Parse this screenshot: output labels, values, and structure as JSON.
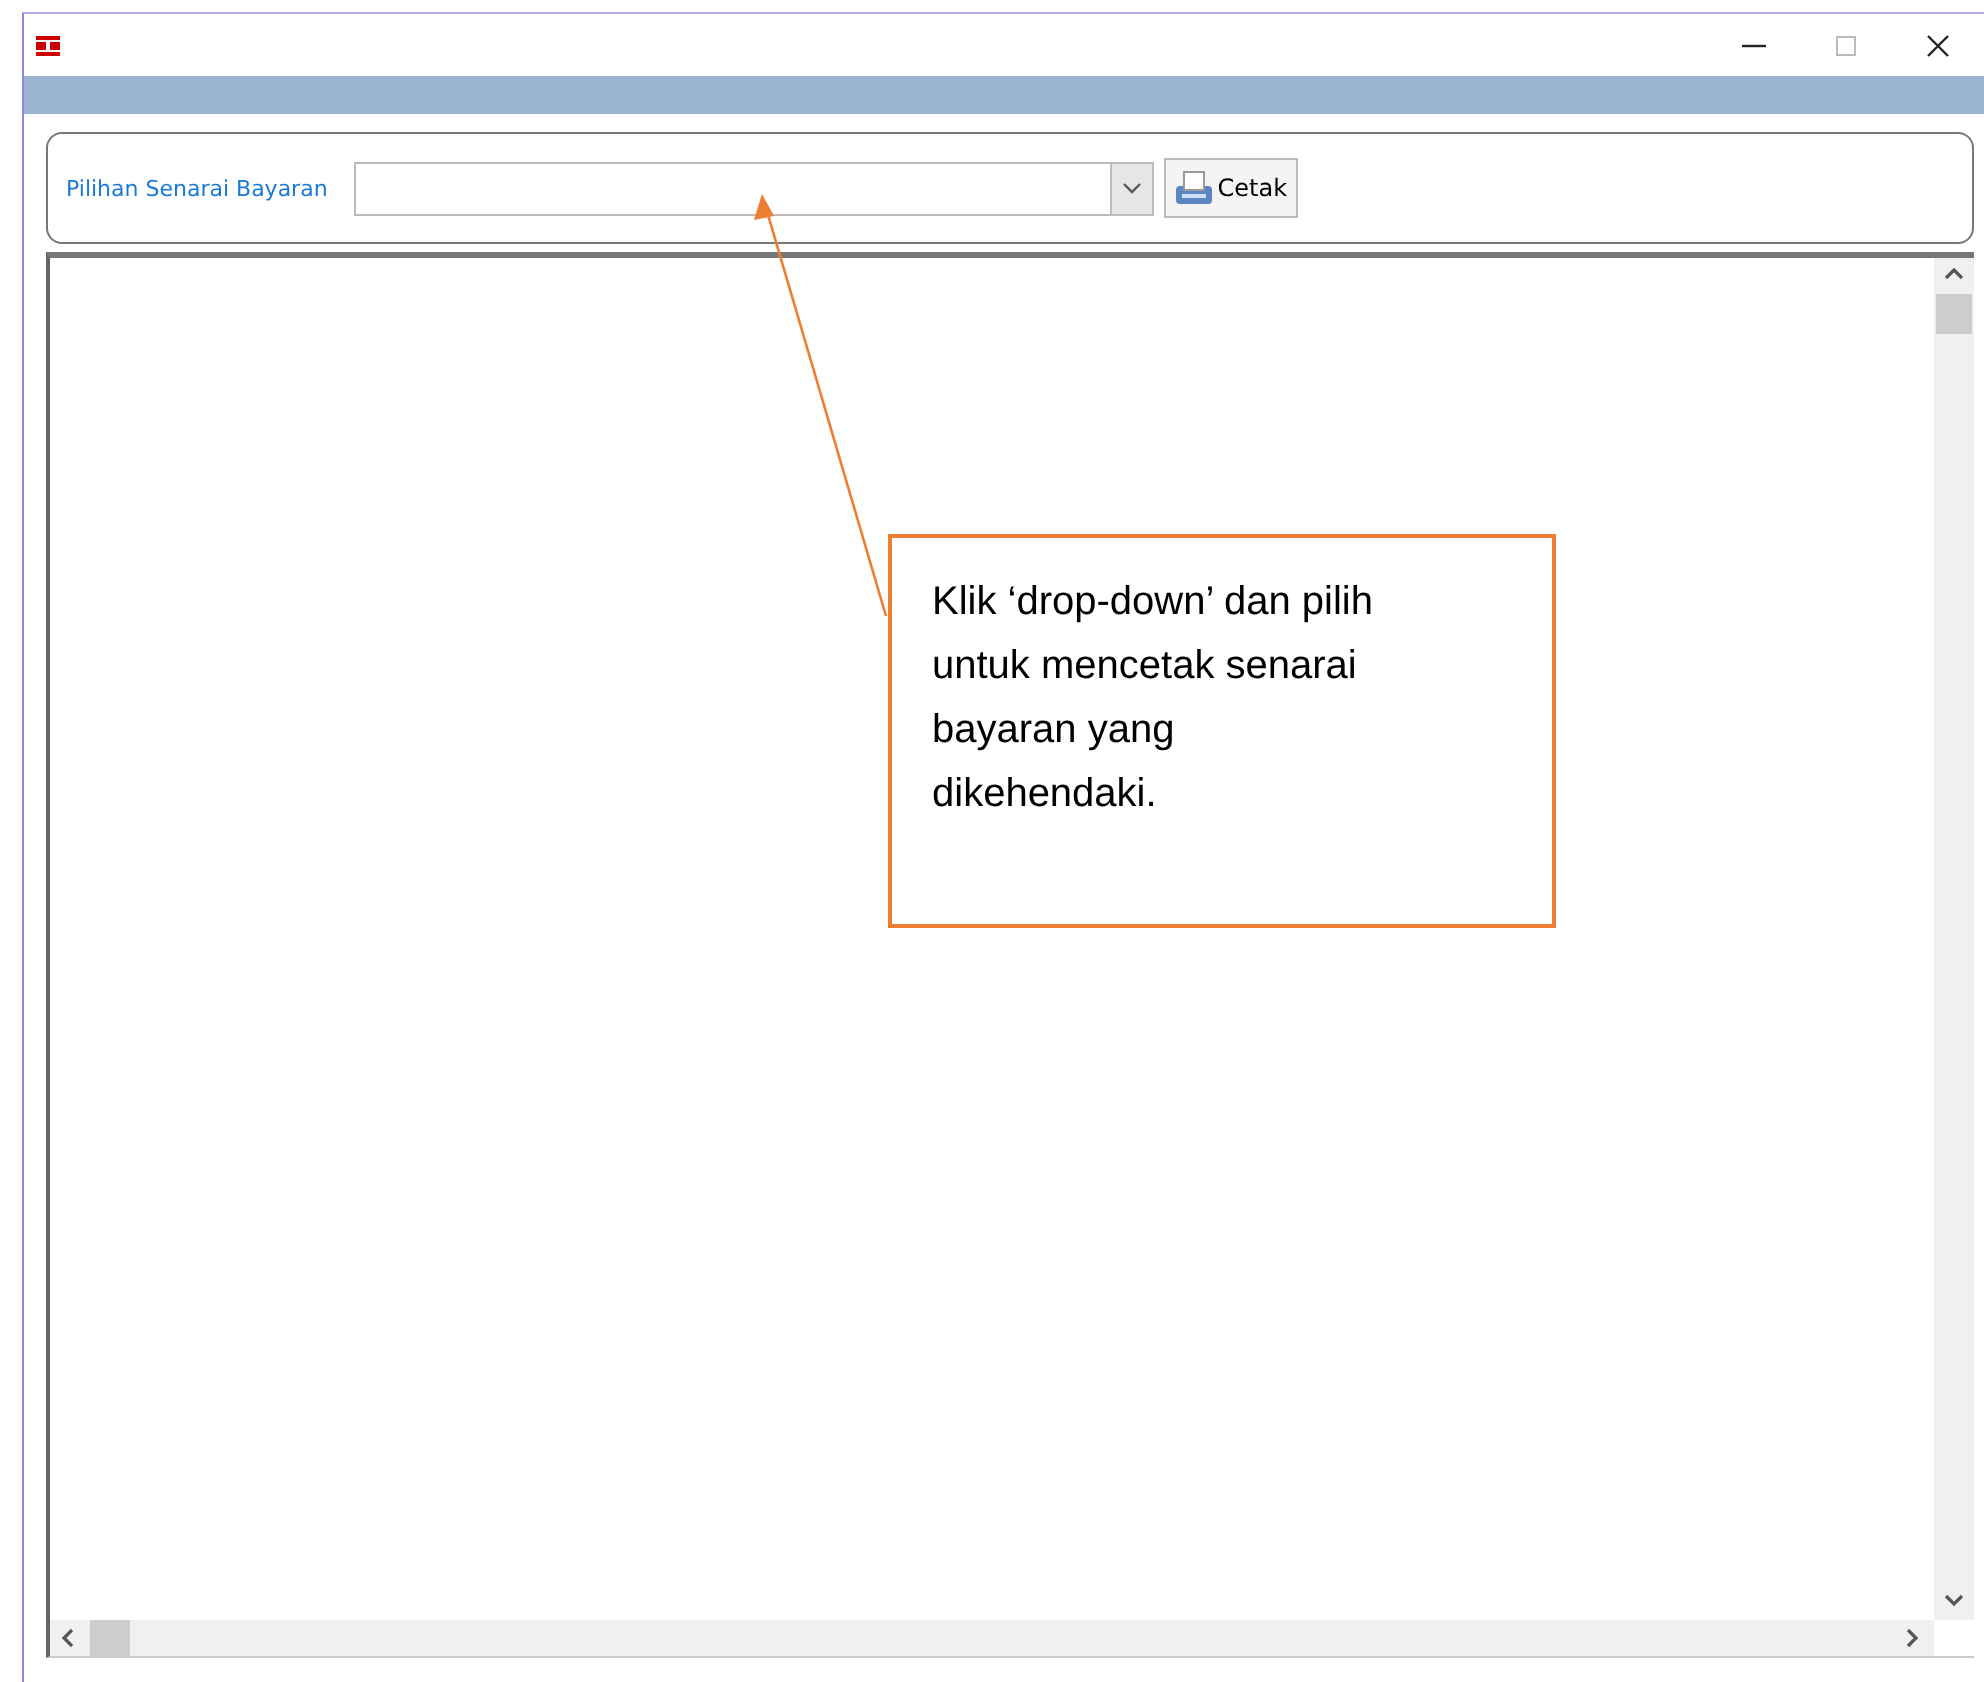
{
  "toolbar": {
    "label": "Pilihan Senarai Bayaran",
    "print_button": "Cetak"
  },
  "callout": {
    "text": "Klik ‘drop-down’ dan pilih untuk mencetak senarai bayaran yang dikehendaki."
  }
}
